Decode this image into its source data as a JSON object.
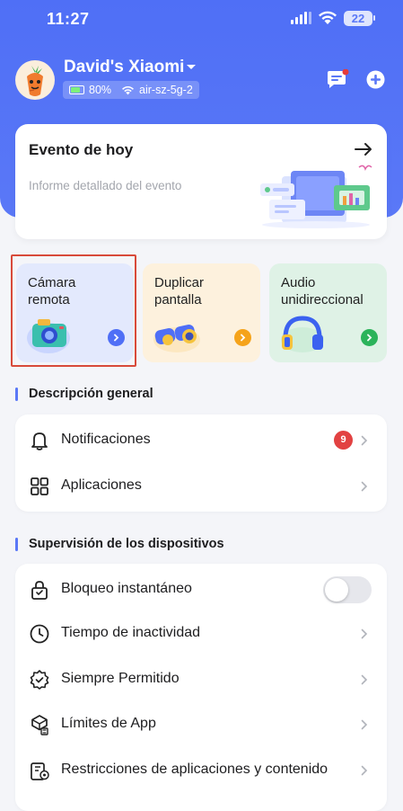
{
  "status": {
    "time": "11:27",
    "battery": "22"
  },
  "device": {
    "name": "David's Xiaomi",
    "battery": "80%",
    "wifi": "air-sz-5g-2"
  },
  "event": {
    "title": "Evento de hoy",
    "subtitle": "Informe detallado del evento"
  },
  "features": [
    {
      "label": "Cámara remota",
      "icon": "camera-icon",
      "color": "#e3e9fd",
      "accent": "#4f6ff6"
    },
    {
      "label": "Duplicar pantalla",
      "icon": "binoculars-icon",
      "color": "#fdf1dd",
      "accent": "#f5a31a"
    },
    {
      "label": "Audio unidireccional",
      "icon": "headphones-icon",
      "color": "#dff2e6",
      "accent": "#2bb35a"
    }
  ],
  "overview": {
    "title": "Descripción general",
    "items": [
      {
        "label": "Notificaciones",
        "icon": "bell-icon",
        "badge": "9"
      },
      {
        "label": "Aplicaciones",
        "icon": "apps-grid-icon"
      }
    ]
  },
  "supervision": {
    "title": "Supervisión de los dispositivos",
    "items": [
      {
        "label": "Bloqueo instantáneo",
        "icon": "lock-icon",
        "toggle": false
      },
      {
        "label": "Tiempo de inactividad",
        "icon": "clock-icon"
      },
      {
        "label": "Siempre Permitido",
        "icon": "check-badge-icon"
      },
      {
        "label": "Límites de App",
        "icon": "app-limit-icon"
      },
      {
        "label": "Restricciones de aplicaciones y contenido",
        "icon": "restriction-icon"
      }
    ]
  }
}
